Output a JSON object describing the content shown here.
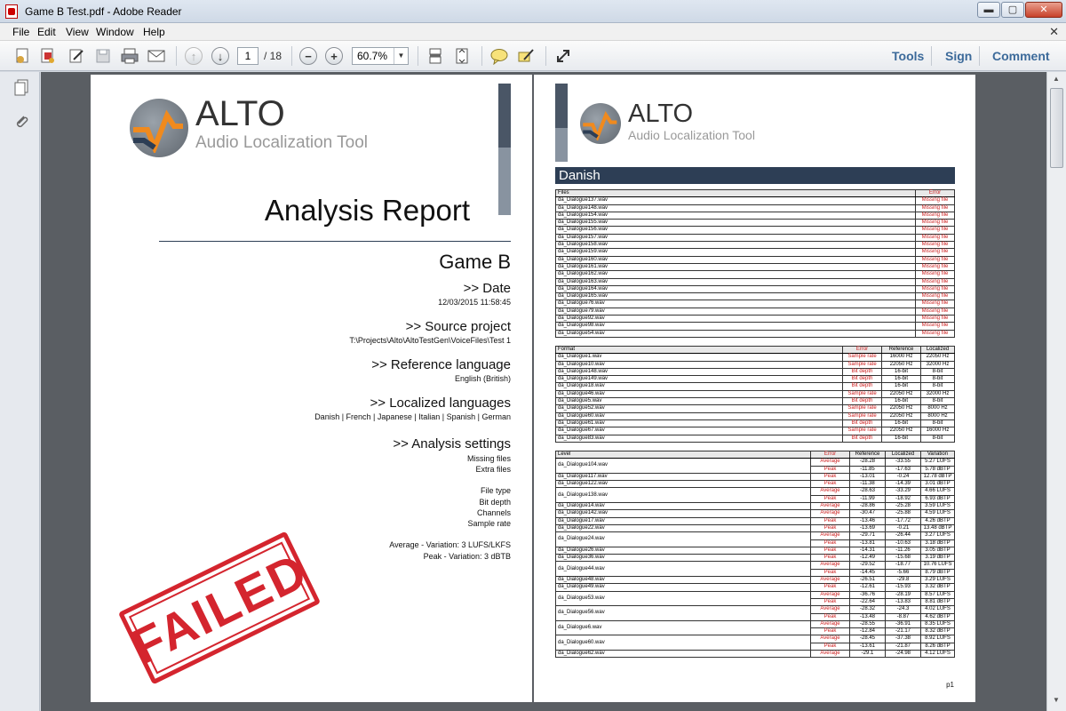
{
  "window": {
    "title": "Game B Test.pdf - Adobe Reader",
    "min_label": "▬",
    "max_label": "▢",
    "close_label": "✕"
  },
  "menu": {
    "items": [
      "File",
      "Edit",
      "View",
      "Window",
      "Help"
    ],
    "close_doc_label": "✕"
  },
  "toolbar": {
    "page_current": "1",
    "page_total": "/ 18",
    "zoom": "60.7%",
    "tools_label": "Tools",
    "sign_label": "Sign",
    "comment_label": "Comment"
  },
  "logo": {
    "name": "ALTO",
    "tagline": "Audio Localization Tool"
  },
  "cover": {
    "title": "Analysis Report",
    "game": "Game B",
    "sections": [
      {
        "heading": ">> Date",
        "lines": [
          "12/03/2015 11:58:45"
        ]
      },
      {
        "heading": ">> Source project",
        "lines": [
          "T:\\Projects\\Alto\\AltoTestGen\\VoiceFiles\\Test 1"
        ]
      },
      {
        "heading": ">> Reference language",
        "lines": [
          "English (British)"
        ]
      },
      {
        "heading": ">> Localized languages",
        "lines": [
          "Danish | French | Japanese | Italian | Spanish | German"
        ]
      },
      {
        "heading": ">> Analysis settings",
        "lines": [
          "Missing files",
          "Extra files",
          "",
          "File type",
          "Bit depth",
          "Channels",
          "Sample rate",
          "",
          "Average - Variation: 3 LUFS/LKFS",
          "Peak - Variation: 3 dBTB"
        ]
      }
    ],
    "stamp": "FAILED"
  },
  "report": {
    "language": "Danish",
    "page_number": "p1",
    "files_table": {
      "headers": [
        "Files",
        "Error"
      ],
      "rows": [
        [
          "da_Dialogue137.wav",
          "Missing file"
        ],
        [
          "da_Dialogue148.wav",
          "Missing file"
        ],
        [
          "da_Dialogue154.wav",
          "Missing file"
        ],
        [
          "da_Dialogue155.wav",
          "Missing file"
        ],
        [
          "da_Dialogue156.wav",
          "Missing file"
        ],
        [
          "da_Dialogue157.wav",
          "Missing file"
        ],
        [
          "da_Dialogue158.wav",
          "Missing file"
        ],
        [
          "da_Dialogue159.wav",
          "Missing file"
        ],
        [
          "da_Dialogue160.wav",
          "Missing file"
        ],
        [
          "da_Dialogue161.wav",
          "Missing file"
        ],
        [
          "da_Dialogue162.wav",
          "Missing file"
        ],
        [
          "da_Dialogue163.wav",
          "Missing file"
        ],
        [
          "da_Dialogue164.wav",
          "Missing file"
        ],
        [
          "da_Dialogue165.wav",
          "Missing file"
        ],
        [
          "da_Dialogue76.wav",
          "Missing file"
        ],
        [
          "da_Dialogue79.wav",
          "Missing file"
        ],
        [
          "da_Dialogue92.wav",
          "Missing file"
        ],
        [
          "da_Dialogue98.wav",
          "Missing file"
        ],
        [
          "da_Dialogue54.wav",
          "Missing file"
        ]
      ]
    },
    "format_table": {
      "headers": [
        "Format",
        "Error",
        "Reference",
        "Localized"
      ],
      "rows": [
        [
          "da_Dialogue1.wav",
          "Sample rate",
          "16000 Hz",
          "22050 Hz"
        ],
        [
          "da_Dialogue10.wav",
          "Sample rate",
          "22050 Hz",
          "32000 Hz"
        ],
        [
          "da_Dialogue148.wav",
          "Bit depth",
          "16-bit",
          "8-bit"
        ],
        [
          "da_Dialogue149.wav",
          "Bit depth",
          "16-bit",
          "8-bit"
        ],
        [
          "da_Dialogue18.wav",
          "Bit depth",
          "16-bit",
          "8-bit"
        ],
        [
          "da_Dialogue46.wav",
          "Sample rate",
          "22050 Hz",
          "32000 Hz"
        ],
        [
          "da_Dialogue5.wav",
          "Bit depth",
          "16-bit",
          "8-bit"
        ],
        [
          "da_Dialogue52.wav",
          "Sample rate",
          "22050 Hz",
          "8000 Hz"
        ],
        [
          "da_Dialogue60.wav",
          "Sample rate",
          "22050 Hz",
          "8000 Hz"
        ],
        [
          "da_Dialogue61.wav",
          "Bit depth",
          "16-bit",
          "8-bit"
        ],
        [
          "da_Dialogue67.wav",
          "Sample rate",
          "22050 Hz",
          "16000 Hz"
        ],
        [
          "da_Dialogue83.wav",
          "Bit depth",
          "16-bit",
          "8-bit"
        ]
      ]
    },
    "level_table": {
      "headers": [
        "Level",
        "Error",
        "Reference",
        "Localized",
        "Variation"
      ],
      "groups": [
        {
          "file": "da_Dialogue104.wav",
          "rows": [
            [
              "Average",
              "-28.28",
              "-33.55",
              "5.27 LUFS"
            ],
            [
              "Peak",
              "-11.85",
              "-17.63",
              "5.78 dBTP"
            ]
          ]
        },
        {
          "file": "da_Dialogue117.wav",
          "rows": [
            [
              "Peak",
              "-13.01",
              "-0.24",
              "12.78 dBTP"
            ]
          ]
        },
        {
          "file": "da_Dialogue122.wav",
          "rows": [
            [
              "Peak",
              "-11.38",
              "-14.39",
              "3.01 dBTP"
            ]
          ]
        },
        {
          "file": "da_Dialogue138.wav",
          "rows": [
            [
              "Average",
              "-28.63",
              "-33.29",
              "4.66 LUFS"
            ],
            [
              "Peak",
              "-11.99",
              "-18.92",
              "6.93 dBTP"
            ]
          ]
        },
        {
          "file": "da_Dialogue14.wav",
          "rows": [
            [
              "Average",
              "-28.86",
              "-25.28",
              "3.59 LUFS"
            ]
          ]
        },
        {
          "file": "da_Dialogue142.wav",
          "rows": [
            [
              "Average",
              "-30.47",
              "-25.88",
              "4.59 LUFS"
            ]
          ]
        },
        {
          "file": "da_Dialogue17.wav",
          "rows": [
            [
              "Peak",
              "-13.46",
              "-17.72",
              "4.26 dBTP"
            ]
          ]
        },
        {
          "file": "da_Dialogue22.wav",
          "rows": [
            [
              "Peak",
              "-13.69",
              "-0.21",
              "13.48 dBTP"
            ]
          ]
        },
        {
          "file": "da_Dialogue24.wav",
          "rows": [
            [
              "Average",
              "-29.71",
              "-26.44",
              "3.27 LUFS"
            ],
            [
              "Peak",
              "-13.81",
              "-10.63",
              "3.18 dBTP"
            ]
          ]
        },
        {
          "file": "da_Dialogue26.wav",
          "rows": [
            [
              "Peak",
              "-14.31",
              "-11.26",
              "3.05 dBTP"
            ]
          ]
        },
        {
          "file": "da_Dialogue36.wav",
          "rows": [
            [
              "Peak",
              "-12.49",
              "-15.68",
              "3.19 dBTP"
            ]
          ]
        },
        {
          "file": "da_Dialogue44.wav",
          "rows": [
            [
              "Average",
              "-29.52",
              "-18.77",
              "10.76 LUFS"
            ],
            [
              "Peak",
              "-14.45",
              "-5.66",
              "8.79 dBTP"
            ]
          ]
        },
        {
          "file": "da_Dialogue48.wav",
          "rows": [
            [
              "Average",
              "-26.51",
              "-29.8",
              "3.29 LUFS"
            ]
          ]
        },
        {
          "file": "da_Dialogue49.wav",
          "rows": [
            [
              "Peak",
              "-12.61",
              "-15.93",
              "3.32 dBTP"
            ]
          ]
        },
        {
          "file": "da_Dialogue53.wav",
          "rows": [
            [
              "Average",
              "-36.76",
              "-28.19",
              "8.57 LUFS"
            ],
            [
              "Peak",
              "-22.64",
              "-13.83",
              "8.81 dBTP"
            ]
          ]
        },
        {
          "file": "da_Dialogue56.wav",
          "rows": [
            [
              "Average",
              "-28.32",
              "-24.3",
              "4.02 LUFS"
            ],
            [
              "Peak",
              "-13.48",
              "-8.87",
              "4.62 dBTP"
            ]
          ]
        },
        {
          "file": "da_Dialogue6.wav",
          "rows": [
            [
              "Average",
              "-28.55",
              "-36.91",
              "8.35 LUFS"
            ],
            [
              "Peak",
              "-12.84",
              "-21.17",
              "8.32 dBTP"
            ]
          ]
        },
        {
          "file": "da_Dialogue60.wav",
          "rows": [
            [
              "Average",
              "-28.45",
              "-37.38",
              "8.92 LUFS"
            ],
            [
              "Peak",
              "-13.61",
              "-21.87",
              "8.26 dBTP"
            ]
          ]
        },
        {
          "file": "da_Dialogue62.wav",
          "rows": [
            [
              "Average",
              "-29.1",
              "-24.98",
              "4.12 LUFS"
            ]
          ]
        }
      ]
    }
  }
}
